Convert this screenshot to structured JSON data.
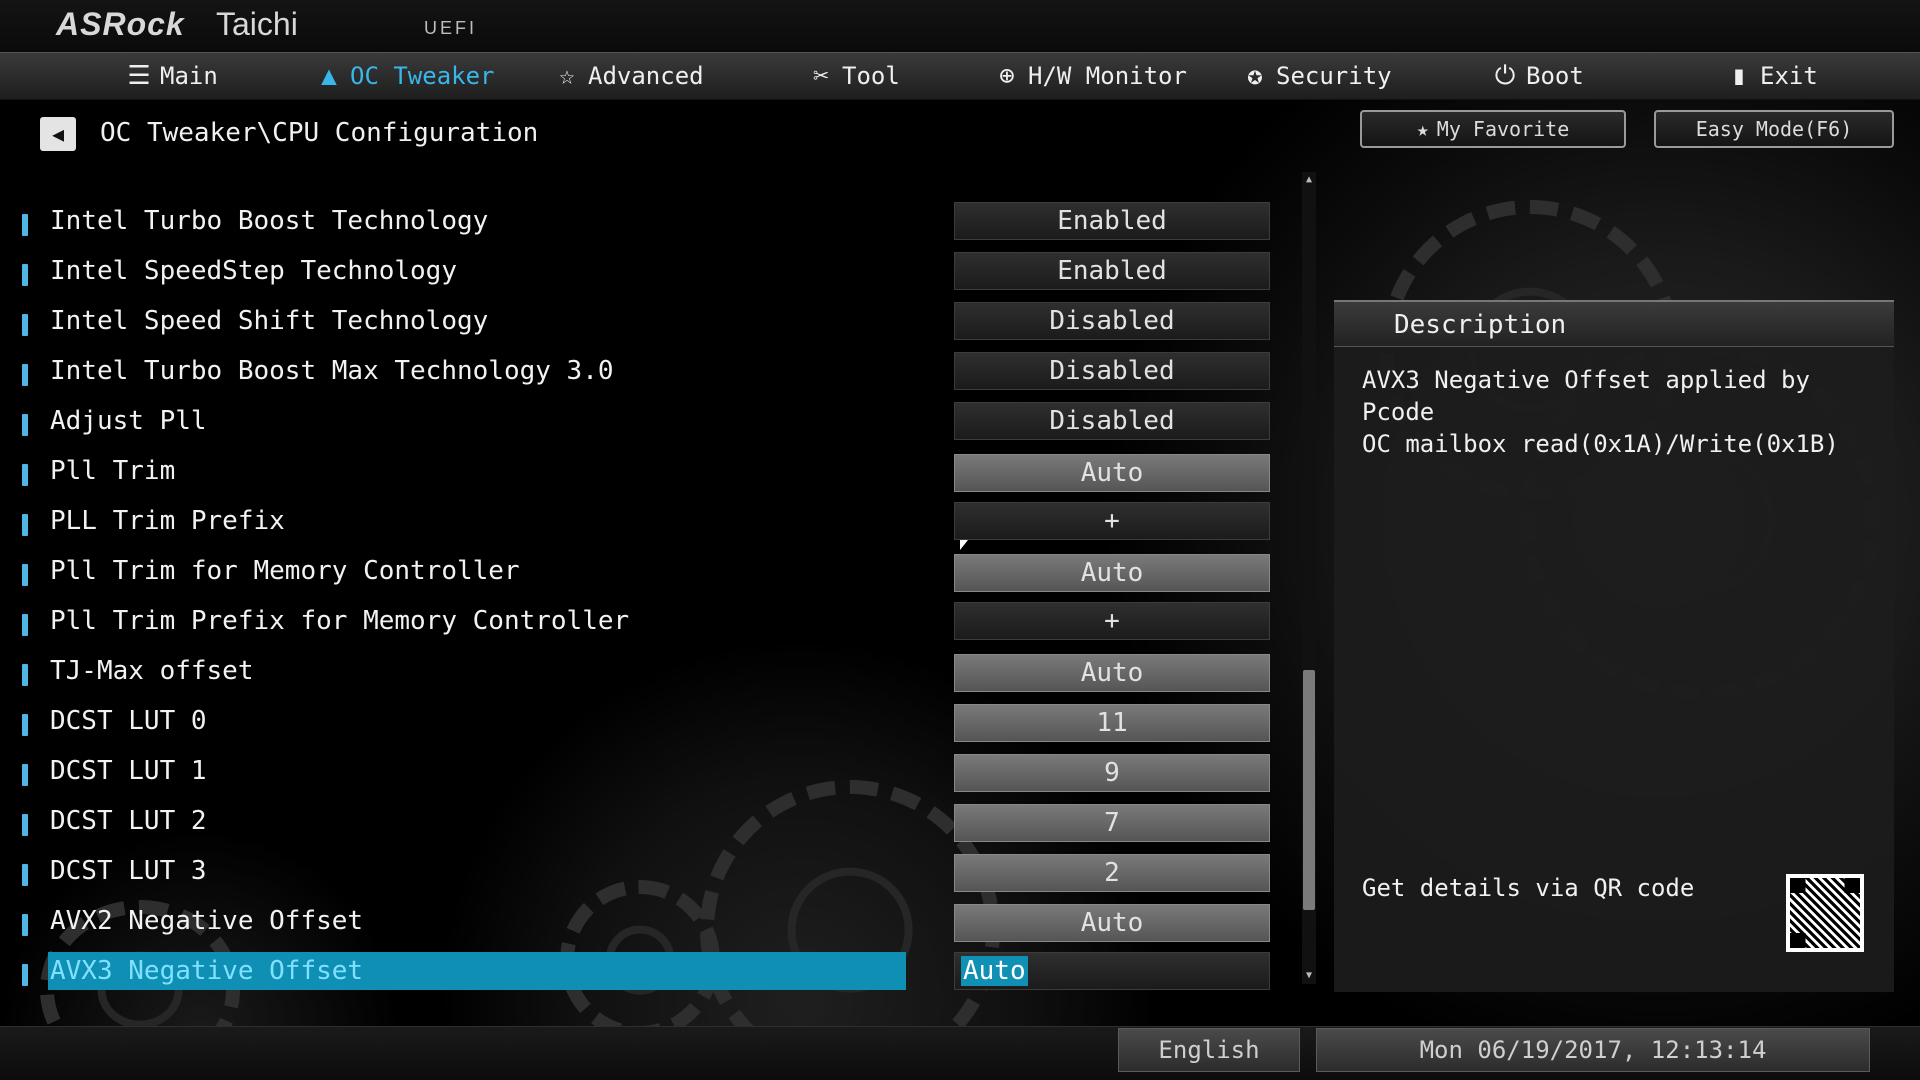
{
  "header": {
    "brand": "ASRock",
    "model": "Taichi",
    "firmware": "UEFI"
  },
  "nav": {
    "items": [
      {
        "label": "Main",
        "icon": "list-icon",
        "glyph": "☰"
      },
      {
        "label": "OC Tweaker",
        "icon": "rocket-icon",
        "glyph": "🚀"
      },
      {
        "label": "Advanced",
        "icon": "star-icon",
        "glyph": "☆"
      },
      {
        "label": "Tool",
        "icon": "tools-icon",
        "glyph": "✂"
      },
      {
        "label": "H/W Monitor",
        "icon": "monitor-icon",
        "glyph": "⊕"
      },
      {
        "label": "Security",
        "icon": "shield-icon",
        "glyph": "✪"
      },
      {
        "label": "Boot",
        "icon": "power-icon",
        "glyph": "⏻"
      },
      {
        "label": "Exit",
        "icon": "exit-icon",
        "glyph": "▮"
      }
    ],
    "active_index": 1
  },
  "breadcrumb": "OC Tweaker\\CPU Configuration",
  "top_buttons": {
    "favorite": "My Favorite",
    "easy_mode": "Easy Mode(F6)"
  },
  "settings": [
    {
      "label": "Intel Turbo Boost Technology",
      "value": "Enabled",
      "style": "dark"
    },
    {
      "label": "Intel SpeedStep Technology",
      "value": "Enabled",
      "style": "dark"
    },
    {
      "label": "Intel Speed Shift Technology",
      "value": "Disabled",
      "style": "dark"
    },
    {
      "label": "Intel Turbo Boost Max Technology 3.0",
      "value": "Disabled",
      "style": "dark"
    },
    {
      "label": "Adjust Pll",
      "value": "Disabled",
      "style": "dark"
    },
    {
      "label": "Pll Trim",
      "value": "Auto",
      "style": "light"
    },
    {
      "label": "PLL Trim Prefix",
      "value": "+",
      "style": "dark"
    },
    {
      "label": "Pll Trim for Memory Controller",
      "value": "Auto",
      "style": "light"
    },
    {
      "label": "Pll Trim Prefix for Memory Controller",
      "value": "+",
      "style": "dark"
    },
    {
      "label": "TJ-Max offset",
      "value": "Auto",
      "style": "light"
    },
    {
      "label": "DCST LUT 0",
      "value": "11",
      "style": "light"
    },
    {
      "label": "DCST LUT 1",
      "value": "9",
      "style": "light"
    },
    {
      "label": "DCST LUT 2",
      "value": "7",
      "style": "light"
    },
    {
      "label": "DCST LUT 3",
      "value": "2",
      "style": "light"
    },
    {
      "label": "AVX2 Negative Offset",
      "value": "Auto",
      "style": "light"
    },
    {
      "label": "AVX3 Negative Offset",
      "value": "Auto",
      "style": "selected"
    }
  ],
  "description": {
    "title": "Description",
    "text": "AVX3 Negative Offset applied by Pcode\nOC mailbox read(0x1A)/Write(0x1B)",
    "qr_text": "Get details via QR code"
  },
  "footer": {
    "language": "English",
    "datetime": "Mon 06/19/2017, 12:13:14"
  },
  "colors": {
    "accent": "#39b7e8",
    "selected_row": "#0f8fb3"
  }
}
